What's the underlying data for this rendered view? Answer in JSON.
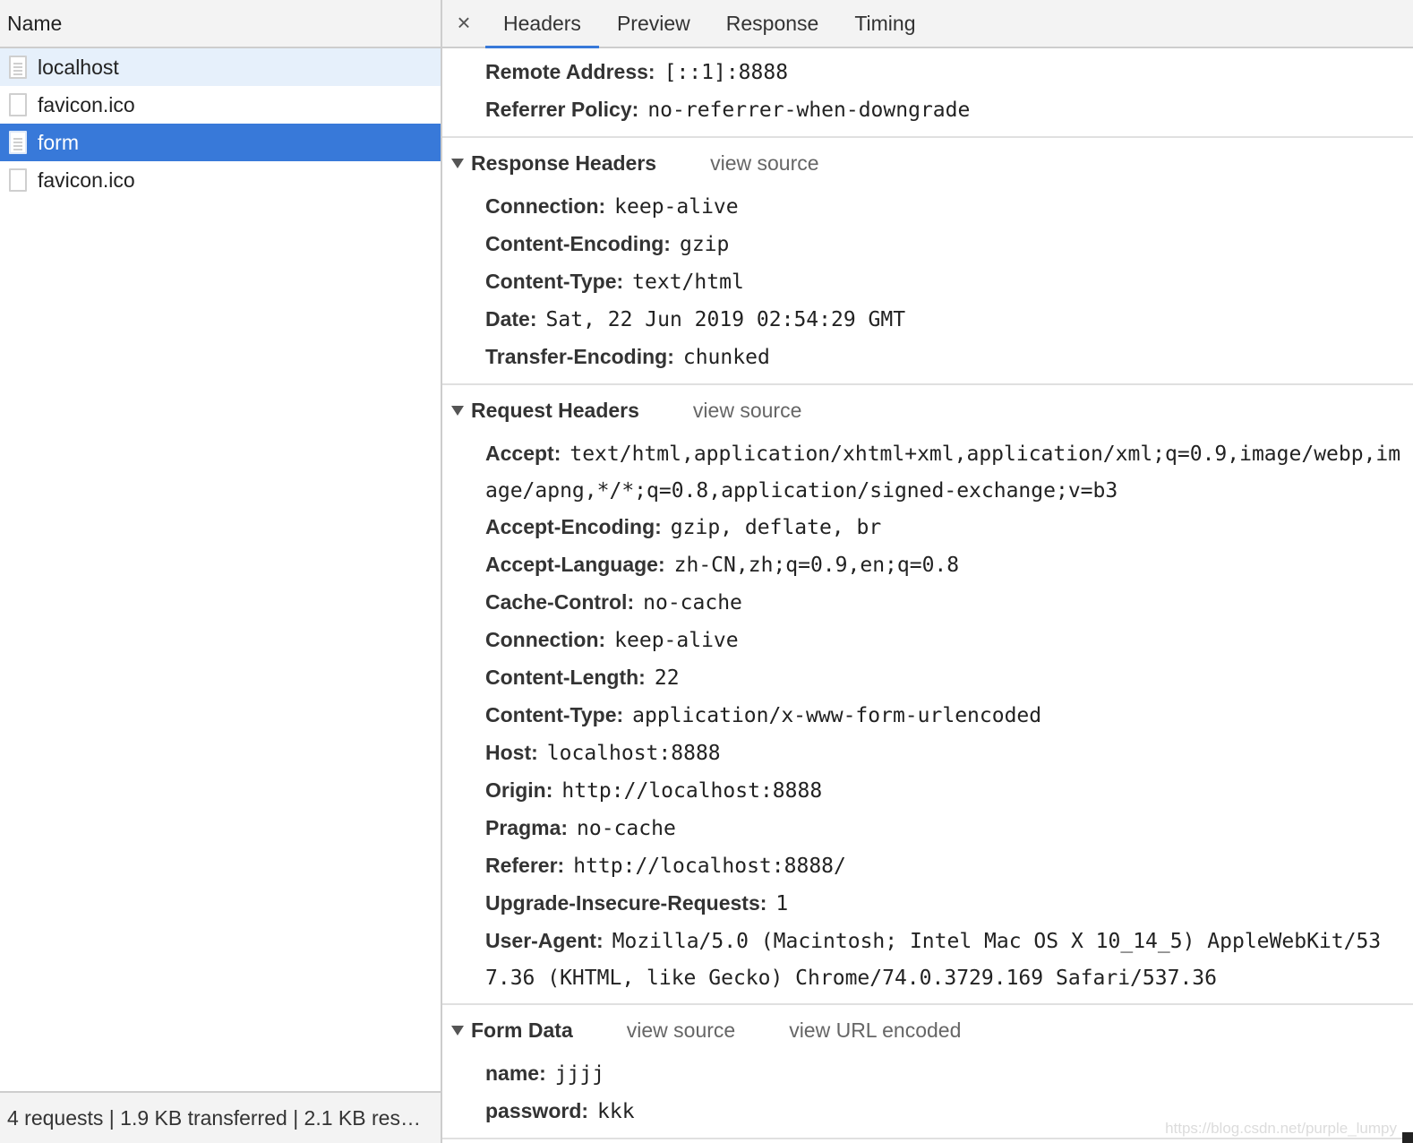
{
  "left_panel": {
    "header": "Name",
    "requests": [
      {
        "name": "localhost",
        "icon": "document-icon"
      },
      {
        "name": "favicon.ico",
        "icon": "blank-file-icon"
      },
      {
        "name": "form",
        "icon": "document-icon"
      },
      {
        "name": "favicon.ico",
        "icon": "blank-file-icon"
      }
    ],
    "status": "4 requests | 1.9 KB transferred | 2.1 KB res…"
  },
  "tabs": {
    "close": "×",
    "items": [
      "Headers",
      "Preview",
      "Response",
      "Timing"
    ],
    "active": "Headers"
  },
  "general": {
    "rows": [
      {
        "key": "Remote Address:",
        "value": "[::1]:8888"
      },
      {
        "key": "Referrer Policy:",
        "value": "no-referrer-when-downgrade"
      }
    ]
  },
  "response_headers": {
    "title": "Response Headers",
    "link": "view source",
    "rows": [
      {
        "key": "Connection:",
        "value": "keep-alive"
      },
      {
        "key": "Content-Encoding:",
        "value": "gzip"
      },
      {
        "key": "Content-Type:",
        "value": "text/html"
      },
      {
        "key": "Date:",
        "value": "Sat, 22 Jun 2019 02:54:29 GMT"
      },
      {
        "key": "Transfer-Encoding:",
        "value": "chunked"
      }
    ]
  },
  "request_headers": {
    "title": "Request Headers",
    "link": "view source",
    "rows": [
      {
        "key": "Accept:",
        "value": "text/html,application/xhtml+xml,application/xml;q=0.9,image/webp,image/apng,*/*;q=0.8,application/signed-exchange;v=b3"
      },
      {
        "key": "Accept-Encoding:",
        "value": "gzip, deflate, br"
      },
      {
        "key": "Accept-Language:",
        "value": "zh-CN,zh;q=0.9,en;q=0.8"
      },
      {
        "key": "Cache-Control:",
        "value": "no-cache"
      },
      {
        "key": "Connection:",
        "value": "keep-alive"
      },
      {
        "key": "Content-Length:",
        "value": "22"
      },
      {
        "key": "Content-Type:",
        "value": "application/x-www-form-urlencoded"
      },
      {
        "key": "Host:",
        "value": "localhost:8888"
      },
      {
        "key": "Origin:",
        "value": "http://localhost:8888"
      },
      {
        "key": "Pragma:",
        "value": "no-cache"
      },
      {
        "key": "Referer:",
        "value": "http://localhost:8888/"
      },
      {
        "key": "Upgrade-Insecure-Requests:",
        "value": "1"
      },
      {
        "key": "User-Agent:",
        "value": "Mozilla/5.0 (Macintosh; Intel Mac OS X 10_14_5) AppleWebKit/537.36 (KHTML, like Gecko) Chrome/74.0.3729.169 Safari/537.36"
      }
    ]
  },
  "form_data": {
    "title": "Form Data",
    "link": "view source",
    "link2": "view URL encoded",
    "rows": [
      {
        "key": "name:",
        "value": "jjjj"
      },
      {
        "key": "password:",
        "value": "kkk"
      }
    ]
  },
  "watermark": "https://blog.csdn.net/purple_lumpy",
  "colors": {
    "selected_row": "#3879d9",
    "alt_row": "#e6f0fb",
    "active_tab_underline": "#3879d9"
  }
}
